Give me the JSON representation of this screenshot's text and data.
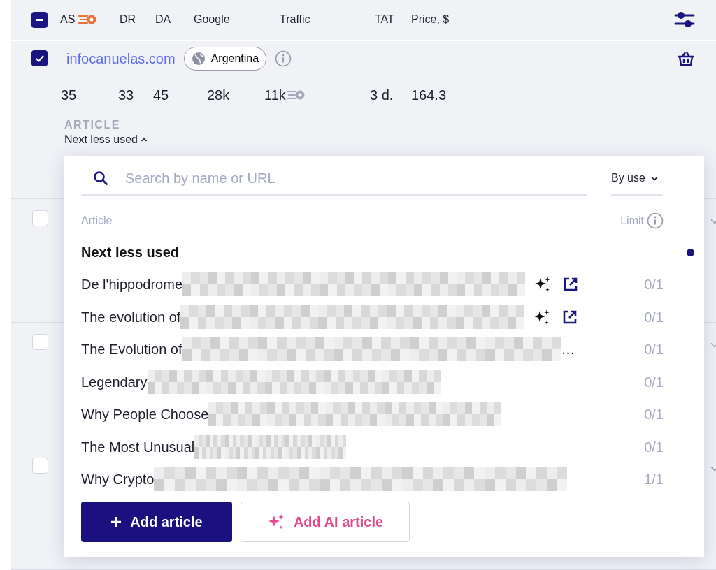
{
  "table": {
    "select_all": {
      "checked": true,
      "indeterminate": true
    },
    "columns": [
      {
        "label": "AS"
      },
      {
        "label": "DR"
      },
      {
        "label": "DA"
      },
      {
        "label": "Google"
      },
      {
        "label": "Traffic"
      },
      {
        "label": "TAT"
      },
      {
        "label": "Price, $"
      }
    ]
  },
  "selected_row": {
    "checked": true,
    "site": "infocanuelas.com",
    "country": "Argentina",
    "values": [
      "35",
      "33",
      "45",
      "28k",
      "11k",
      "3 d.",
      "164.3"
    ],
    "article_label": "ARTICLE",
    "article_value": "Next less used",
    "expanded": true
  },
  "other_rows": [
    {
      "checked": false
    },
    {
      "checked": false
    },
    {
      "checked": false
    }
  ],
  "article_popup": {
    "search": {
      "placeholder": "Search by name or URL"
    },
    "sort": "By use",
    "columns": [
      "Article",
      "Limit"
    ],
    "default_option": {
      "label": "Next less used",
      "selected": true
    },
    "articles": [
      {
        "title": "De l'hippodrome",
        "ai": true,
        "link": true,
        "limit": "0/1"
      },
      {
        "title": "The evolution of",
        "ai": true,
        "link": true,
        "limit": "0/1"
      },
      {
        "title": "The Evolution of",
        "ai": false,
        "link": false,
        "ellipsis": "…",
        "limit": "0/1"
      },
      {
        "title": "Legendary",
        "ai": false,
        "link": false,
        "limit": "0/1"
      },
      {
        "title": "Why People Choose",
        "ai": false,
        "link": false,
        "limit": "0/1"
      },
      {
        "title": "The Most Unusual",
        "ai": false,
        "link": false,
        "limit": "0/1"
      },
      {
        "title": "Why Crypto",
        "ai": false,
        "link": false,
        "limit": "1/1"
      }
    ],
    "buttons": [
      {
        "kind": "primary",
        "label": "Add article"
      },
      {
        "kind": "ai",
        "label": "Add AI article"
      }
    ]
  }
}
